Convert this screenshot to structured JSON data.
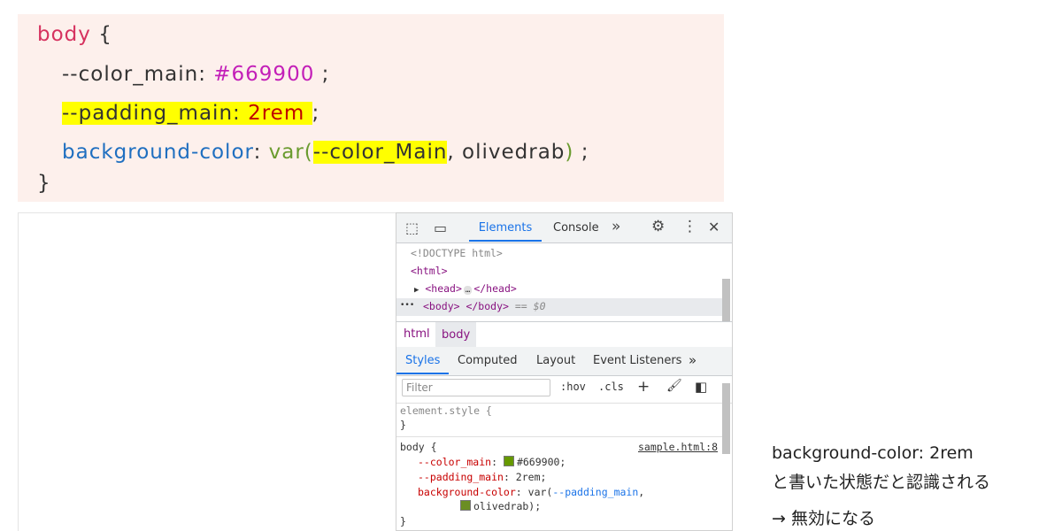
{
  "code": {
    "selector": "body",
    "brace_open": "{",
    "brace_close": "}",
    "line2": {
      "prop": "--color_main",
      "colon": ":",
      "value": "#669900",
      "semi": ";"
    },
    "line3": {
      "prop": "--padding_main",
      "colon": ":",
      "value": "2rem",
      "semi": ";"
    },
    "line4": {
      "prop": "background-color",
      "colon": ":",
      "fn": "var(",
      "arg": "--color_Main",
      "comma": ",",
      "fallback": "olivedrab",
      "close": ")",
      "semi": ";"
    }
  },
  "devtools": {
    "toolbar": {
      "inspect_icon": "⬚",
      "device_icon": "▭",
      "tab_elements": "Elements",
      "tab_console": "Console",
      "more": "»",
      "gear_icon": "⚙",
      "kebab_icon": "⋮",
      "close_icon": "✕"
    },
    "dom": {
      "doctype": "<!DOCTYPE html>",
      "html_open": "<html>",
      "head_arrow": "▶",
      "head_open": "<head>",
      "head_dots": "…",
      "head_close": "</head>",
      "row_dots": "•••",
      "body_tags": "<body> </body>",
      "eq_marker": "== $0"
    },
    "breadcrumb": {
      "html": "html",
      "body": "body"
    },
    "subtabs": {
      "styles": "Styles",
      "computed": "Computed",
      "layout": "Layout",
      "listeners": "Event Listeners",
      "more": "»"
    },
    "filter": {
      "placeholder": "Filter",
      "hov": ":hov",
      "cls": ".cls",
      "plus": "+",
      "paint": "🖌",
      "toggle": "◧"
    },
    "element_style": {
      "label": "element.style {",
      "close": "}"
    },
    "body_rule": {
      "selector": "body {",
      "source": "sample.html:8",
      "p1_name": "--color_main",
      "p1_value": "#669900;",
      "p1_swatch": "#669900",
      "p2_name": "--padding_main",
      "p2_value": "2rem;",
      "p3_name": "background-color",
      "p3_value_pre": "var(",
      "p3_var": "--padding_main",
      "p3_value_post": ",",
      "p3_fallback": "olivedrab);",
      "p3_swatch": "#6b8e23",
      "close": "}"
    }
  },
  "annotation": {
    "line1": "background-color: 2rem",
    "line2": "と書いた状態だと認識される",
    "line3": "→ 無効になる"
  }
}
